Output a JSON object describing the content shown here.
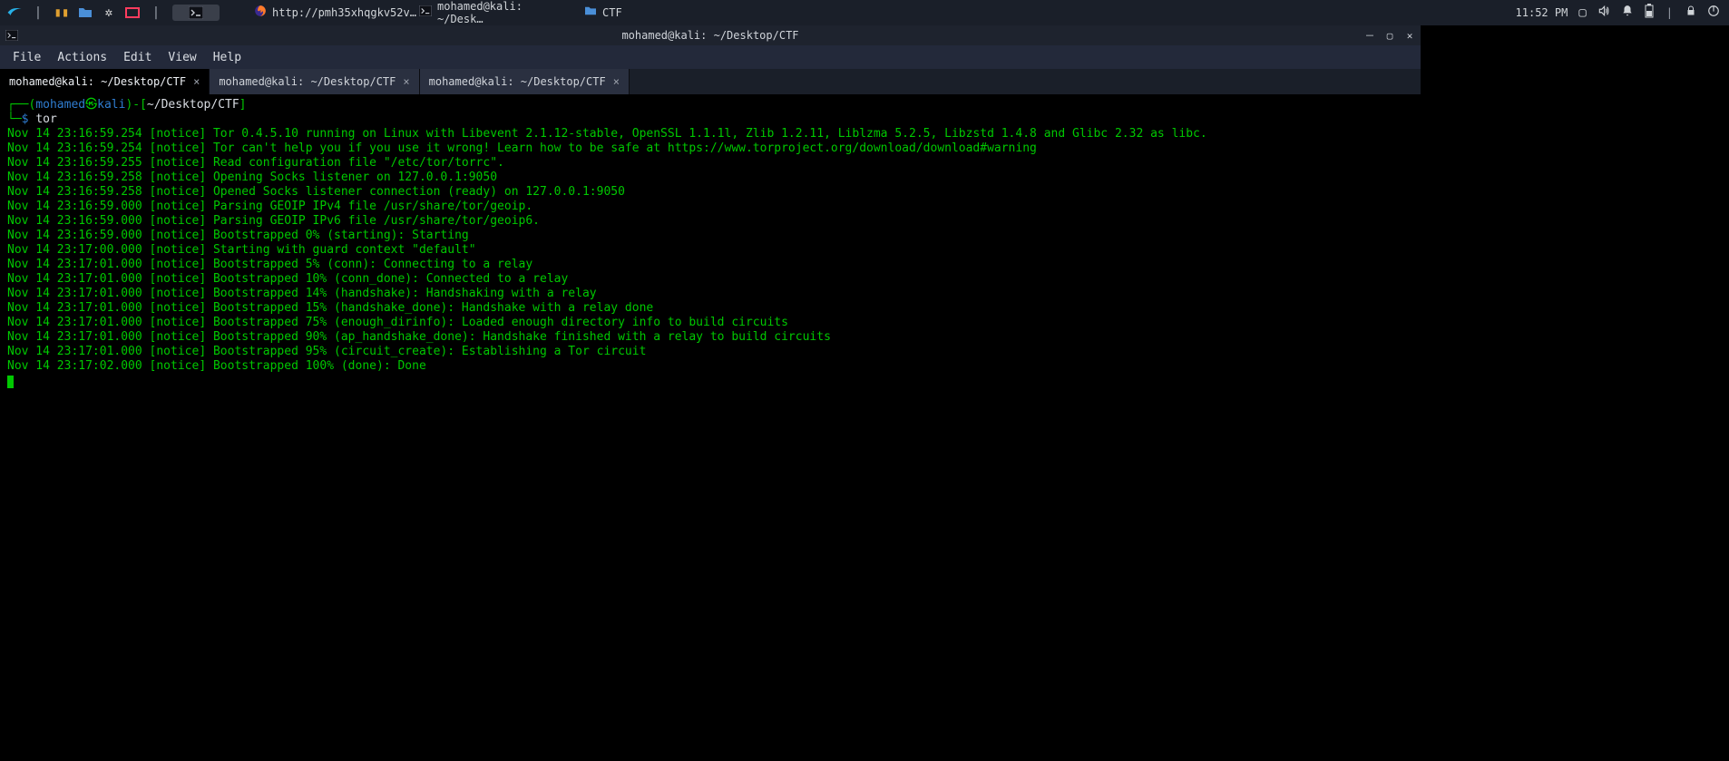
{
  "panel": {
    "tasks": [
      {
        "icon": "firefox",
        "label": "http://pmh35xhqgkv52v…"
      },
      {
        "icon": "terminal",
        "label": "mohamed@kali: ~/Desk…"
      },
      {
        "icon": "folder",
        "label": "CTF"
      }
    ],
    "clock": "11:52 PM"
  },
  "window": {
    "title": "mohamed@kali: ~/Desktop/CTF",
    "menu": [
      "File",
      "Actions",
      "Edit",
      "View",
      "Help"
    ],
    "tabs": [
      {
        "label": "mohamed@kali: ~/Desktop/CTF",
        "active": true
      },
      {
        "label": "mohamed@kali: ~/Desktop/CTF",
        "active": false
      },
      {
        "label": "mohamed@kali: ~/Desktop/CTF",
        "active": false
      }
    ],
    "prompt": {
      "user": "mohamed",
      "host": "kali",
      "cwd": "~/Desktop/CTF",
      "command": "tor"
    },
    "output": [
      "Nov 14 23:16:59.254 [notice] Tor 0.4.5.10 running on Linux with Libevent 2.1.12-stable, OpenSSL 1.1.1l, Zlib 1.2.11, Liblzma 5.2.5, Libzstd 1.4.8 and Glibc 2.32 as libc.",
      "Nov 14 23:16:59.254 [notice] Tor can't help you if you use it wrong! Learn how to be safe at https://www.torproject.org/download/download#warning",
      "Nov 14 23:16:59.255 [notice] Read configuration file \"/etc/tor/torrc\".",
      "Nov 14 23:16:59.258 [notice] Opening Socks listener on 127.0.0.1:9050",
      "Nov 14 23:16:59.258 [notice] Opened Socks listener connection (ready) on 127.0.0.1:9050",
      "Nov 14 23:16:59.000 [notice] Parsing GEOIP IPv4 file /usr/share/tor/geoip.",
      "Nov 14 23:16:59.000 [notice] Parsing GEOIP IPv6 file /usr/share/tor/geoip6.",
      "Nov 14 23:16:59.000 [notice] Bootstrapped 0% (starting): Starting",
      "Nov 14 23:17:00.000 [notice] Starting with guard context \"default\"",
      "Nov 14 23:17:01.000 [notice] Bootstrapped 5% (conn): Connecting to a relay",
      "Nov 14 23:17:01.000 [notice] Bootstrapped 10% (conn_done): Connected to a relay",
      "Nov 14 23:17:01.000 [notice] Bootstrapped 14% (handshake): Handshaking with a relay",
      "Nov 14 23:17:01.000 [notice] Bootstrapped 15% (handshake_done): Handshake with a relay done",
      "Nov 14 23:17:01.000 [notice] Bootstrapped 75% (enough_dirinfo): Loaded enough directory info to build circuits",
      "Nov 14 23:17:01.000 [notice] Bootstrapped 90% (ap_handshake_done): Handshake finished with a relay to build circuits",
      "Nov 14 23:17:01.000 [notice] Bootstrapped 95% (circuit_create): Establishing a Tor circuit",
      "Nov 14 23:17:02.000 [notice] Bootstrapped 100% (done): Done"
    ]
  }
}
